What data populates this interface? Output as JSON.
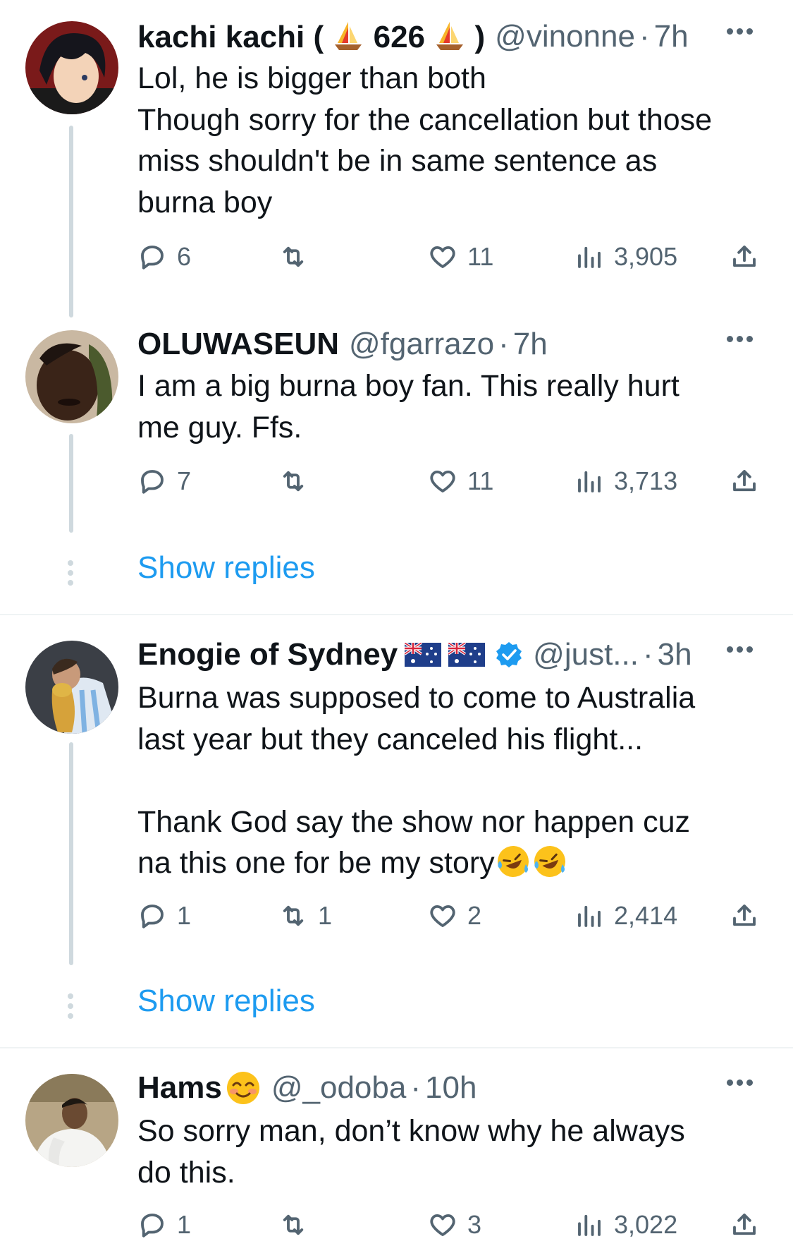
{
  "tweets": [
    {
      "name_before": "kachi kachi (",
      "name_number": "626",
      "name_after": ")",
      "handle": "@vinonne",
      "time": "7h",
      "lines": [
        "Lol, he is bigger than both",
        "Though sorry for the cancellation but those",
        "miss shouldn't be in same sentence as",
        "burna boy"
      ],
      "replies": "6",
      "retweets": "",
      "likes": "11",
      "views": "3,905"
    },
    {
      "name": "OLUWASEUN",
      "handle": "@fgarrazo",
      "time": "7h",
      "lines": [
        "I am a big burna boy fan. This really hurt",
        "me guy. Ffs."
      ],
      "replies": "7",
      "retweets": "",
      "likes": "11",
      "views": "3,713"
    },
    {
      "name": "Enogie of Sydney",
      "handle": "@just...",
      "time": "3h",
      "lines": [
        "Burna was supposed to come to Australia",
        "last year but they canceled his flight...",
        "",
        "Thank God say the show nor happen cuz",
        "na this one for be my story"
      ],
      "replies": "1",
      "retweets": "1",
      "likes": "2",
      "views": "2,414"
    },
    {
      "name": "Hams",
      "handle": "@_odoba",
      "time": "10h",
      "lines": [
        "So sorry man, don’t know why he always",
        "do this."
      ],
      "replies": "1",
      "retweets": "",
      "likes": "3",
      "views": "3,022"
    }
  ],
  "show_replies_label": "Show replies",
  "dot_sep": "·",
  "icons": {
    "reply": "reply-icon",
    "retweet": "retweet-icon",
    "like": "heart-icon",
    "views": "views-icon",
    "share": "share-icon",
    "more": "more-icon",
    "boat": "sailboat-emoji",
    "flag": "australia-flag-emoji",
    "verified": "verified-badge-icon",
    "laugh": "rofl-emoji",
    "smile": "smiling-face-emoji"
  },
  "colors": {
    "link": "#1d9bf0",
    "secondary": "#536471",
    "thread": "#cfd9de",
    "verified": "#1d9bf0"
  }
}
